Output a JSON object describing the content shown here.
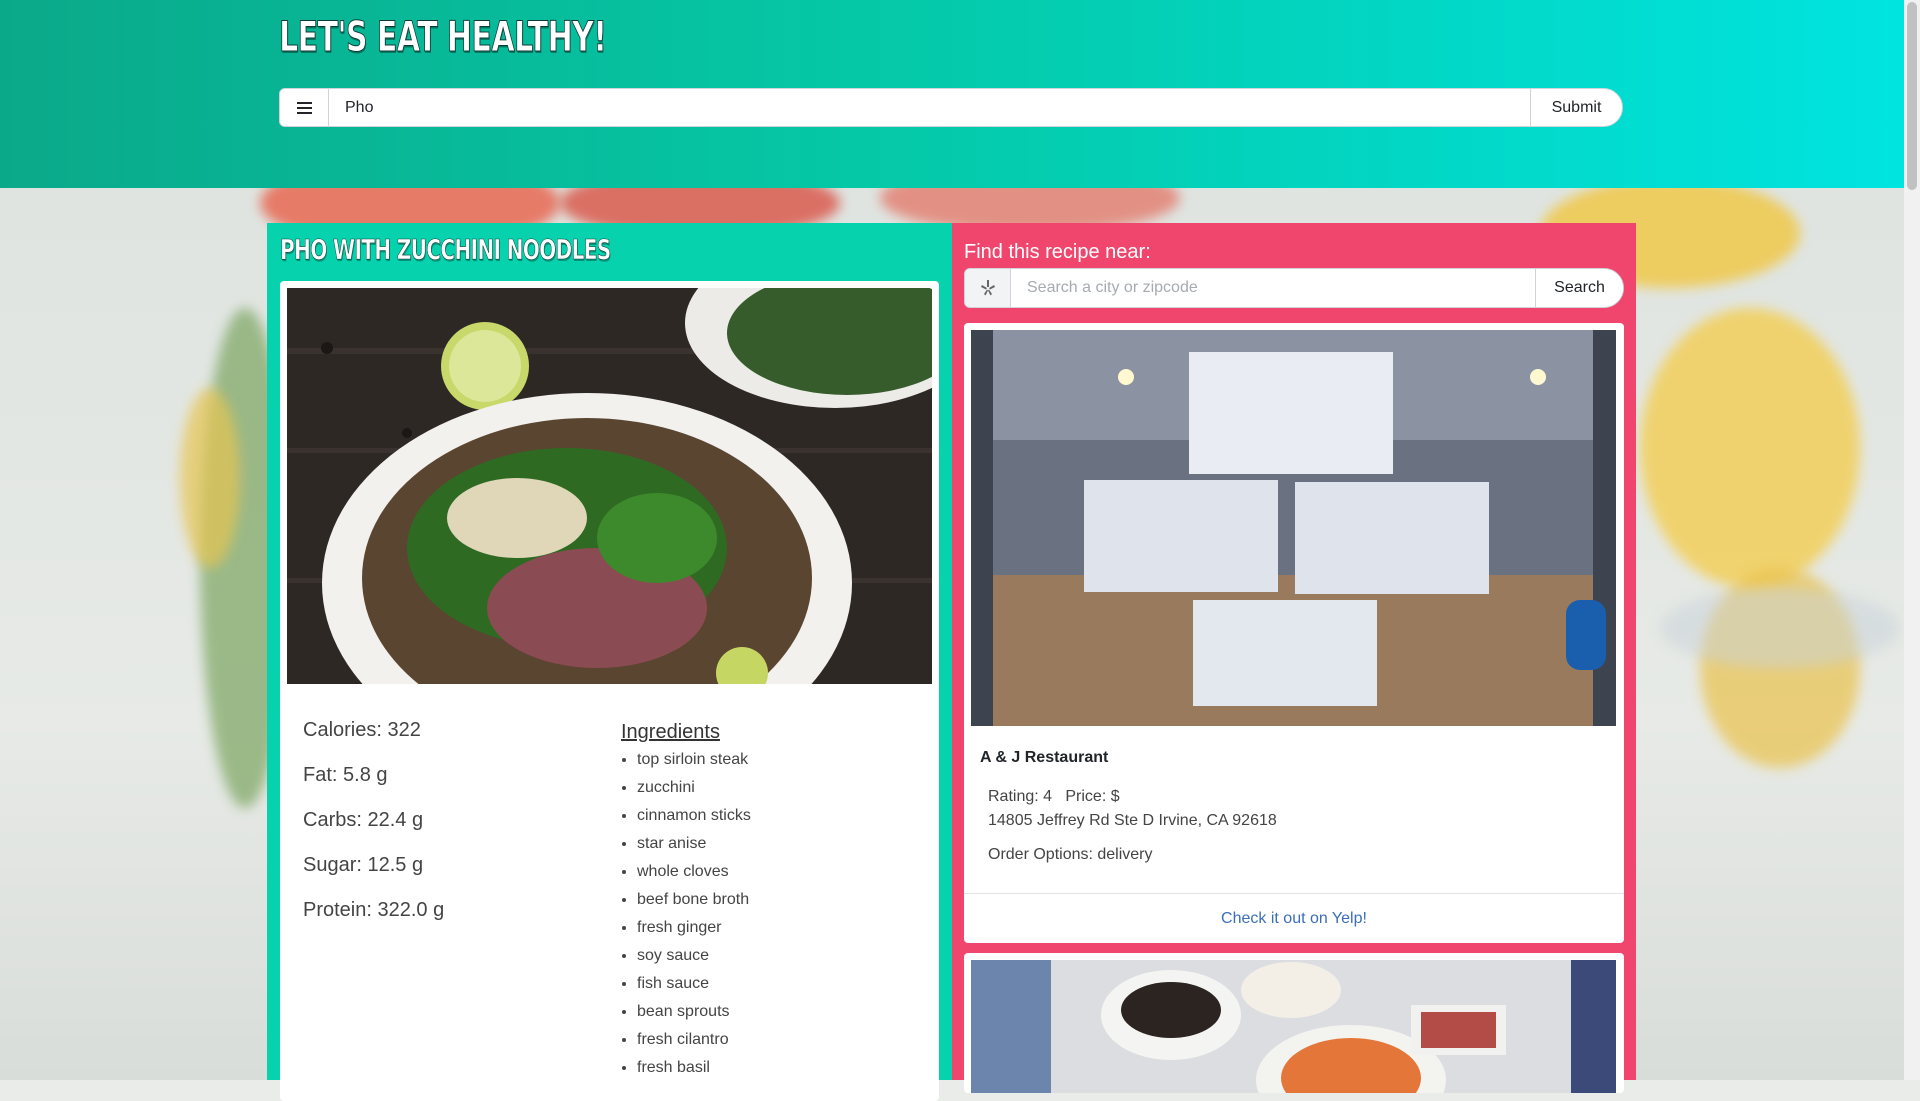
{
  "header": {
    "title": "LET'S EAT HEALTHY!",
    "search_value": "Pho",
    "submit_label": "Submit",
    "gradient": [
      "#0aa98a",
      "#00e4e0"
    ]
  },
  "recipe": {
    "title": "PHO WITH ZUCCHINI NOODLES",
    "nutrition": {
      "calories": "Calories: 322",
      "fat": "Fat: 5.8 g",
      "carbs": "Carbs: 22.4 g",
      "sugar": "Sugar: 12.5 g",
      "protein": "Protein: 322.0 g"
    },
    "ingredients_heading": "Ingredients",
    "ingredients": [
      "top sirloin steak",
      "zucchini",
      "cinnamon sticks",
      "star anise",
      "whole cloves",
      "beef bone broth",
      "fresh ginger",
      "soy sauce",
      "fish sauce",
      "bean sprouts",
      "fresh cilantro",
      "fresh basil"
    ],
    "panel_color": "#06d2ad"
  },
  "yelp": {
    "find_label": "Find this recipe near:",
    "location_placeholder": "Search a city or zipcode",
    "search_label": "Search",
    "icon": "yelp-icon",
    "panel_color": "#f0456d",
    "restaurants": [
      {
        "name": "A & J Restaurant",
        "rating_price": "Rating: 4   Price: $",
        "address": "14805 Jeffrey Rd Ste D Irvine, CA 92618",
        "order_options": "Order Options: delivery",
        "link_label": "Check it out on Yelp!"
      }
    ]
  }
}
